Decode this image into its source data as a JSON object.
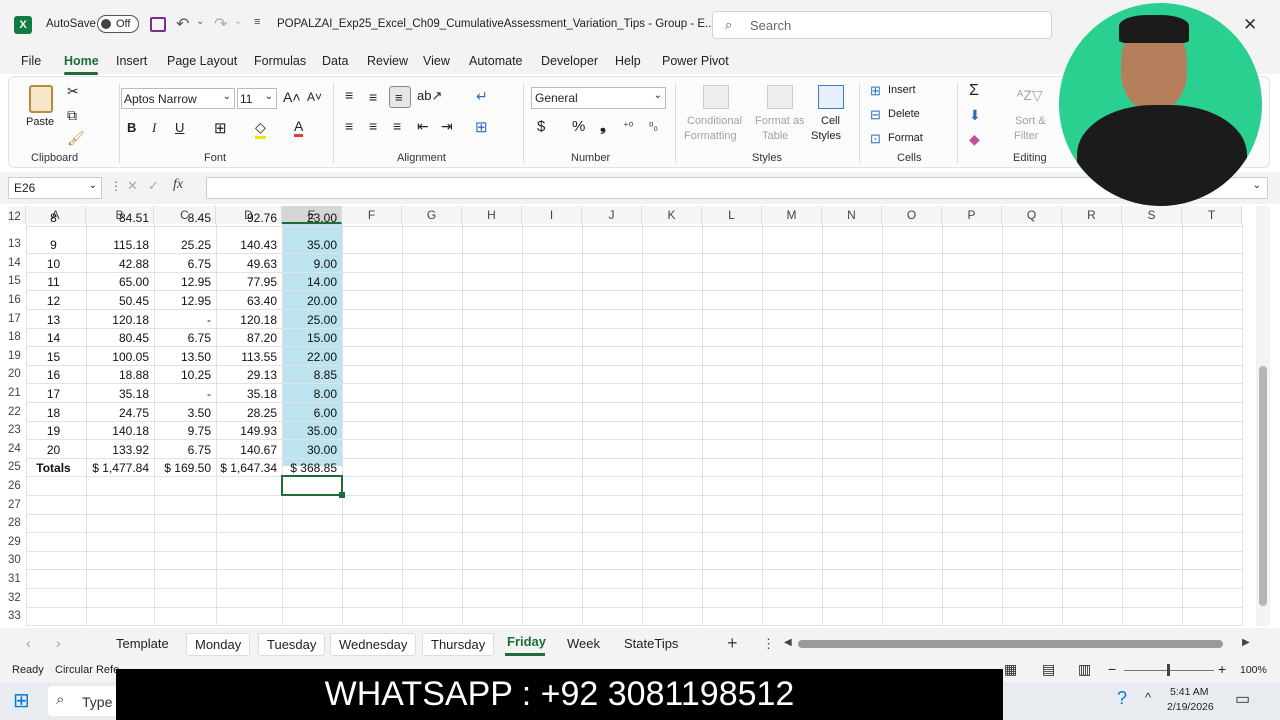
{
  "titlebar": {
    "autosave_label": "AutoSave",
    "autosave_state": "Off",
    "file_title": "POPALZAI_Exp25_Excel_Ch09_CumulativeAssessment_Variation_Tips  -  Group  -  E...",
    "search_placeholder": "Search"
  },
  "menu_tabs": [
    "File",
    "Home",
    "Insert",
    "Page Layout",
    "Formulas",
    "Data",
    "Review",
    "View",
    "Automate",
    "Developer",
    "Help",
    "Power Pivot"
  ],
  "active_tab": "Home",
  "ribbon": {
    "paste": "Paste",
    "clipboard": "Clipboard",
    "font_name": "Aptos Narrow",
    "font_size": "11",
    "font": "Font",
    "alignment": "Alignment",
    "number_format": "General",
    "number": "Number",
    "conditional": "Conditional",
    "formatting": "Formatting",
    "format_as": "Format as",
    "table": "Table",
    "cell": "Cell",
    "styles_btn": "Styles",
    "styles": "Styles",
    "insert": "Insert",
    "delete": "Delete",
    "format": "Format",
    "cells": "Cells",
    "sort": "Sort &",
    "filter": "Filter",
    "editing": "Editing"
  },
  "formula_bar": {
    "name_box": "E26",
    "fx": "fx",
    "content": ""
  },
  "columns": [
    "A",
    "B",
    "C",
    "D",
    "E",
    "F",
    "G",
    "H",
    "I",
    "J",
    "K",
    "L",
    "M",
    "N",
    "O",
    "P",
    "Q",
    "R",
    "S",
    "T"
  ],
  "rows": [
    {
      "n": "12",
      "a": "8",
      "b": "84.51",
      "c": "8.45",
      "d": "92.76",
      "e": "23.00"
    },
    {
      "n": "13",
      "a": "9",
      "b": "115.18",
      "c": "25.25",
      "d": "140.43",
      "e": "35.00"
    },
    {
      "n": "14",
      "a": "10",
      "b": "42.88",
      "c": "6.75",
      "d": "49.63",
      "e": "9.00"
    },
    {
      "n": "15",
      "a": "11",
      "b": "65.00",
      "c": "12.95",
      "d": "77.95",
      "e": "14.00"
    },
    {
      "n": "16",
      "a": "12",
      "b": "50.45",
      "c": "12.95",
      "d": "63.40",
      "e": "20.00"
    },
    {
      "n": "17",
      "a": "13",
      "b": "120.18",
      "c": "-",
      "d": "120.18",
      "e": "25.00"
    },
    {
      "n": "18",
      "a": "14",
      "b": "80.45",
      "c": "6.75",
      "d": "87.20",
      "e": "15.00"
    },
    {
      "n": "19",
      "a": "15",
      "b": "100.05",
      "c": "13.50",
      "d": "113.55",
      "e": "22.00"
    },
    {
      "n": "20",
      "a": "16",
      "b": "18.88",
      "c": "10.25",
      "d": "29.13",
      "e": "8.85"
    },
    {
      "n": "21",
      "a": "17",
      "b": "35.18",
      "c": "-",
      "d": "35.18",
      "e": "8.00"
    },
    {
      "n": "22",
      "a": "18",
      "b": "24.75",
      "c": "3.50",
      "d": "28.25",
      "e": "6.00"
    },
    {
      "n": "23",
      "a": "19",
      "b": "140.18",
      "c": "9.75",
      "d": "149.93",
      "e": "35.00"
    },
    {
      "n": "24",
      "a": "20",
      "b": "133.92",
      "c": "6.75",
      "d": "140.67",
      "e": "30.00"
    },
    {
      "n": "25",
      "a": "Totals",
      "b": "$ 1,477.84",
      "c": "$ 169.50",
      "d": "$ 1,647.34",
      "e": "$ 368.85"
    },
    {
      "n": "26",
      "a": "",
      "b": "",
      "c": "",
      "d": "",
      "e": ""
    },
    {
      "n": "27",
      "a": "",
      "b": "",
      "c": "",
      "d": "",
      "e": ""
    },
    {
      "n": "28",
      "a": "",
      "b": "",
      "c": "",
      "d": "",
      "e": ""
    },
    {
      "n": "29",
      "a": "",
      "b": "",
      "c": "",
      "d": "",
      "e": ""
    },
    {
      "n": "30",
      "a": "",
      "b": "",
      "c": "",
      "d": "",
      "e": ""
    },
    {
      "n": "31",
      "a": "",
      "b": "",
      "c": "",
      "d": "",
      "e": ""
    },
    {
      "n": "32",
      "a": "",
      "b": "",
      "c": "",
      "d": "",
      "e": ""
    },
    {
      "n": "33",
      "a": "",
      "b": "",
      "c": "",
      "d": "",
      "e": ""
    }
  ],
  "sheet_tabs": [
    "Template",
    "Monday",
    "Tuesday",
    "Wednesday",
    "Thursday",
    "Friday",
    "Week",
    "StateTips"
  ],
  "active_sheet": "Friday",
  "status": {
    "ready": "Ready",
    "circular": "Circular Refe",
    "zoom": "100%"
  },
  "taskbar": {
    "search": "Type",
    "time": "5:41 AM",
    "date": "2/19/2026"
  },
  "banner": "WHATSAPP :  +92 3081198512",
  "colors": {
    "selection": "#bde3ef",
    "active_tab": "#1f6b3a",
    "accent": "#107c41"
  }
}
